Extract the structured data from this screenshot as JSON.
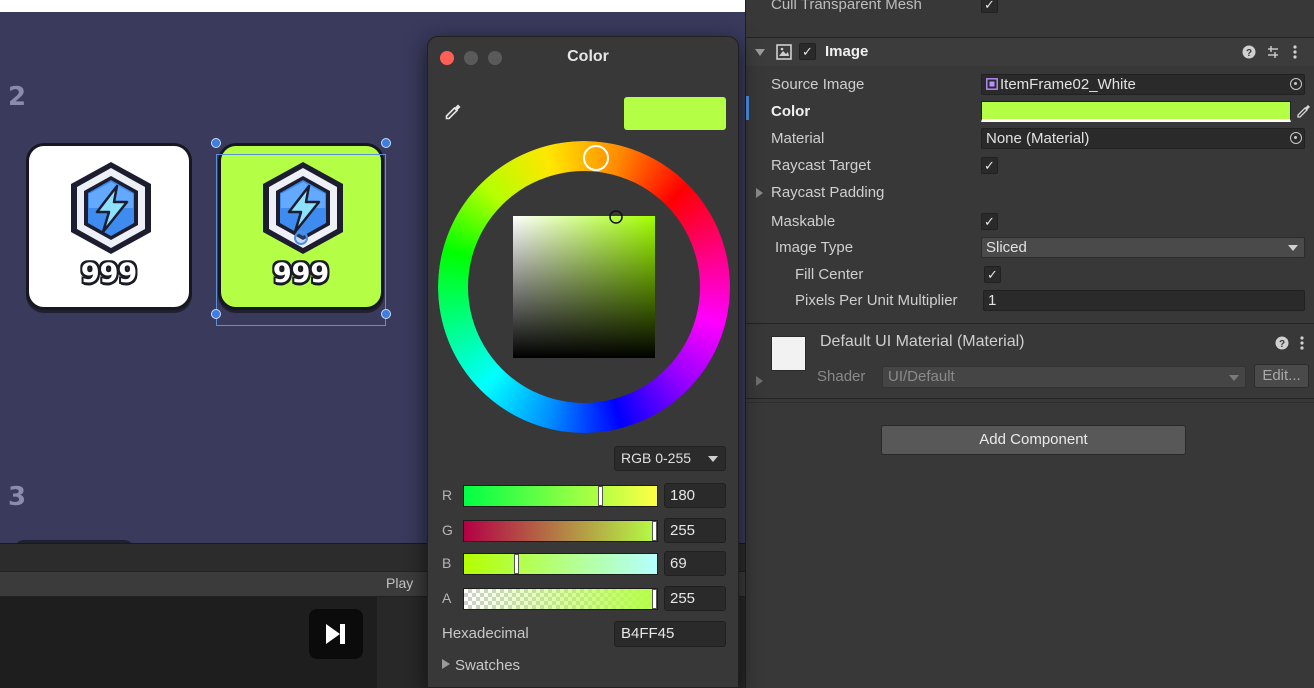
{
  "scene": {
    "row_labels": [
      "2",
      "3"
    ],
    "cards": [
      {
        "count": "999",
        "bg": "#ffffff"
      },
      {
        "count": "999",
        "bg": "#b4ff45"
      }
    ],
    "play_label": "Play"
  },
  "color_picker": {
    "title": "Color",
    "preview_color": "#b4ff45",
    "mode": "RGB 0-255",
    "channels": [
      {
        "label": "R",
        "value": "180"
      },
      {
        "label": "G",
        "value": "255"
      },
      {
        "label": "B",
        "value": "69"
      },
      {
        "label": "A",
        "value": "255"
      }
    ],
    "hex_label": "Hexadecimal",
    "hex_value": "B4FF45",
    "swatches_label": "Swatches"
  },
  "inspector": {
    "prev_component_label": "Cull Transparent Mesh",
    "image_component": {
      "title": "Image",
      "properties": {
        "source_image": {
          "label": "Source Image",
          "value": "ItemFrame02_White"
        },
        "color": {
          "label": "Color",
          "value": "#b4ff45"
        },
        "material": {
          "label": "Material",
          "value": "None (Material)"
        },
        "raycast_target": {
          "label": "Raycast Target",
          "checked": true
        },
        "raycast_padding": {
          "label": "Raycast Padding"
        },
        "maskable": {
          "label": "Maskable",
          "checked": true
        },
        "image_type": {
          "label": "Image Type",
          "value": "Sliced"
        },
        "fill_center": {
          "label": "Fill Center",
          "checked": true
        },
        "ppu_multiplier": {
          "label": "Pixels Per Unit Multiplier",
          "value": "1"
        }
      }
    },
    "material_section": {
      "title": "Default UI Material (Material)",
      "shader_label": "Shader",
      "shader_value": "UI/Default",
      "edit_label": "Edit..."
    },
    "add_component_label": "Add Component"
  }
}
